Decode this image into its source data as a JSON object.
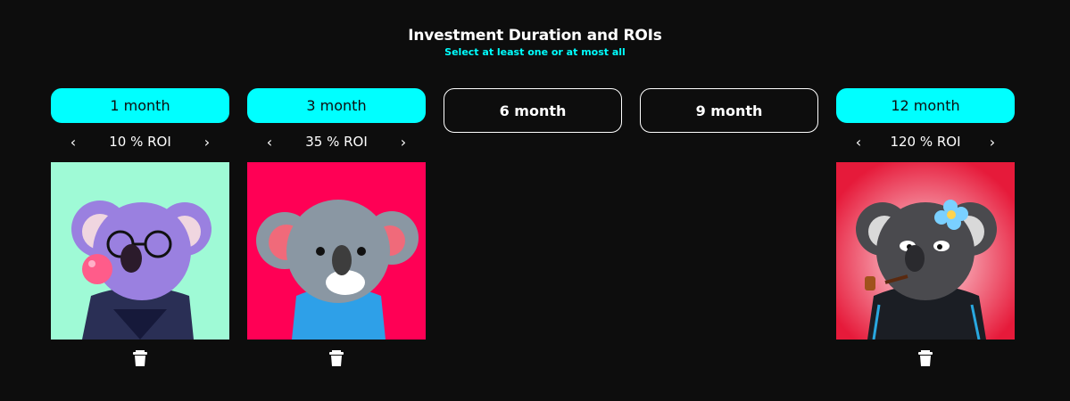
{
  "header": {
    "title": "Investment Duration and ROIs",
    "subtitle": "Select at least one or at most all"
  },
  "durations": [
    {
      "label": "1 month",
      "selected": true,
      "roi": "10 % ROI",
      "nft_bg": "#9ffad6"
    },
    {
      "label": "3 month",
      "selected": true,
      "roi": "35 % ROI",
      "nft_bg": "#ff0055"
    },
    {
      "label": "6 month",
      "selected": false
    },
    {
      "label": "9 month",
      "selected": false
    },
    {
      "label": "12 month",
      "selected": true,
      "roi": "120 % ROI",
      "nft_bg": "#e61a3a"
    }
  ],
  "icons": {
    "prev": "chevron-left-icon",
    "next": "chevron-right-icon",
    "delete": "trash-icon"
  },
  "colors": {
    "accent": "#00ffff",
    "background": "#0d0d0d"
  }
}
